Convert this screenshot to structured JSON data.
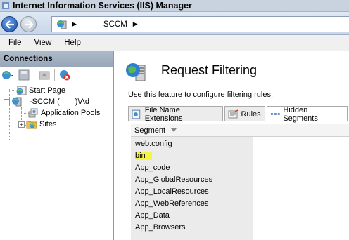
{
  "window": {
    "title": "Internet Information Services (IIS) Manager"
  },
  "address": {
    "crumb": "SCCM"
  },
  "menu": {
    "items": [
      "File",
      "View",
      "Help"
    ]
  },
  "connections": {
    "header": "Connections",
    "tree": {
      "start_page": "Start Page",
      "server": "-SCCM (",
      "server_suffix": ")\\Ad",
      "app_pools": "Application Pools",
      "sites": "Sites"
    }
  },
  "main": {
    "title": "Request Filtering",
    "description": "Use this feature to configure filtering rules.",
    "tabs": [
      {
        "label": "File Name Extensions",
        "active": false
      },
      {
        "label": "Rules",
        "active": false
      },
      {
        "label": "Hidden Segments",
        "active": true
      }
    ],
    "grid": {
      "column": "Segment",
      "rows": [
        "web.config",
        "bin",
        "App_code",
        "App_GlobalResources",
        "App_LocalResources",
        "App_WebReferences",
        "App_Data",
        "App_Browsers"
      ],
      "highlighted_row": "bin",
      "highlight_color": "#f5f542"
    }
  },
  "colors": {
    "titlebar": "#c9d3e0",
    "pane_header": "#aebac8",
    "grid_bg": "#ebebeb"
  }
}
